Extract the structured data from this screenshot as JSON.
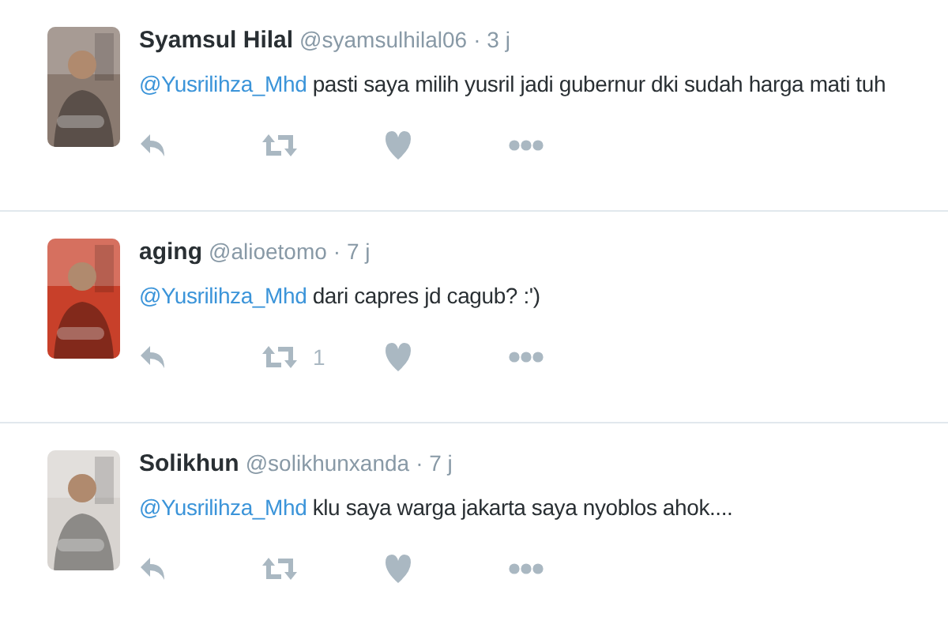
{
  "tweets": [
    {
      "name": "Syamsul Hilal",
      "handle": "@syamsulhilal06",
      "time": "· 3 j",
      "mention": "@Yusrilihza_Mhd",
      "text": "pasti saya milih yusril jadi gubernur dki sudah harga mati tuh"
    },
    {
      "name": "aging",
      "handle": "@alioetomo",
      "time": "· 7 j",
      "mention": "@Yusrilihza_Mhd",
      "text": "dari capres jd cagub? :')",
      "retweet_count": "1"
    },
    {
      "name": "Solikhun",
      "handle": "@solikhunxanda",
      "time": "· 7 j",
      "mention": "@Yusrilihza_Mhd",
      "text": "klu saya warga jakarta saya nyoblos ahok...."
    }
  ]
}
